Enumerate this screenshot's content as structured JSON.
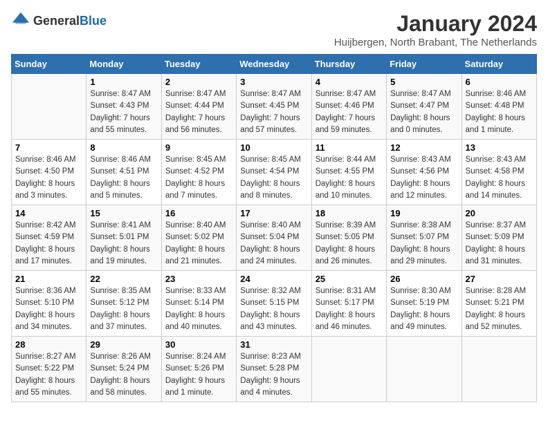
{
  "header": {
    "logo_general": "General",
    "logo_blue": "Blue",
    "title": "January 2024",
    "subtitle": "Huijbergen, North Brabant, The Netherlands"
  },
  "calendar": {
    "days_of_week": [
      "Sunday",
      "Monday",
      "Tuesday",
      "Wednesday",
      "Thursday",
      "Friday",
      "Saturday"
    ],
    "weeks": [
      [
        {
          "day": "",
          "info": ""
        },
        {
          "day": "1",
          "info": "Sunrise: 8:47 AM\nSunset: 4:43 PM\nDaylight: 7 hours\nand 55 minutes."
        },
        {
          "day": "2",
          "info": "Sunrise: 8:47 AM\nSunset: 4:44 PM\nDaylight: 7 hours\nand 56 minutes."
        },
        {
          "day": "3",
          "info": "Sunrise: 8:47 AM\nSunset: 4:45 PM\nDaylight: 7 hours\nand 57 minutes."
        },
        {
          "day": "4",
          "info": "Sunrise: 8:47 AM\nSunset: 4:46 PM\nDaylight: 7 hours\nand 59 minutes."
        },
        {
          "day": "5",
          "info": "Sunrise: 8:47 AM\nSunset: 4:47 PM\nDaylight: 8 hours\nand 0 minutes."
        },
        {
          "day": "6",
          "info": "Sunrise: 8:46 AM\nSunset: 4:48 PM\nDaylight: 8 hours\nand 1 minute."
        }
      ],
      [
        {
          "day": "7",
          "info": "Sunrise: 8:46 AM\nSunset: 4:50 PM\nDaylight: 8 hours\nand 3 minutes."
        },
        {
          "day": "8",
          "info": "Sunrise: 8:46 AM\nSunset: 4:51 PM\nDaylight: 8 hours\nand 5 minutes."
        },
        {
          "day": "9",
          "info": "Sunrise: 8:45 AM\nSunset: 4:52 PM\nDaylight: 8 hours\nand 7 minutes."
        },
        {
          "day": "10",
          "info": "Sunrise: 8:45 AM\nSunset: 4:54 PM\nDaylight: 8 hours\nand 8 minutes."
        },
        {
          "day": "11",
          "info": "Sunrise: 8:44 AM\nSunset: 4:55 PM\nDaylight: 8 hours\nand 10 minutes."
        },
        {
          "day": "12",
          "info": "Sunrise: 8:43 AM\nSunset: 4:56 PM\nDaylight: 8 hours\nand 12 minutes."
        },
        {
          "day": "13",
          "info": "Sunrise: 8:43 AM\nSunset: 4:58 PM\nDaylight: 8 hours\nand 14 minutes."
        }
      ],
      [
        {
          "day": "14",
          "info": "Sunrise: 8:42 AM\nSunset: 4:59 PM\nDaylight: 8 hours\nand 17 minutes."
        },
        {
          "day": "15",
          "info": "Sunrise: 8:41 AM\nSunset: 5:01 PM\nDaylight: 8 hours\nand 19 minutes."
        },
        {
          "day": "16",
          "info": "Sunrise: 8:40 AM\nSunset: 5:02 PM\nDaylight: 8 hours\nand 21 minutes."
        },
        {
          "day": "17",
          "info": "Sunrise: 8:40 AM\nSunset: 5:04 PM\nDaylight: 8 hours\nand 24 minutes."
        },
        {
          "day": "18",
          "info": "Sunrise: 8:39 AM\nSunset: 5:05 PM\nDaylight: 8 hours\nand 26 minutes."
        },
        {
          "day": "19",
          "info": "Sunrise: 8:38 AM\nSunset: 5:07 PM\nDaylight: 8 hours\nand 29 minutes."
        },
        {
          "day": "20",
          "info": "Sunrise: 8:37 AM\nSunset: 5:09 PM\nDaylight: 8 hours\nand 31 minutes."
        }
      ],
      [
        {
          "day": "21",
          "info": "Sunrise: 8:36 AM\nSunset: 5:10 PM\nDaylight: 8 hours\nand 34 minutes."
        },
        {
          "day": "22",
          "info": "Sunrise: 8:35 AM\nSunset: 5:12 PM\nDaylight: 8 hours\nand 37 minutes."
        },
        {
          "day": "23",
          "info": "Sunrise: 8:33 AM\nSunset: 5:14 PM\nDaylight: 8 hours\nand 40 minutes."
        },
        {
          "day": "24",
          "info": "Sunrise: 8:32 AM\nSunset: 5:15 PM\nDaylight: 8 hours\nand 43 minutes."
        },
        {
          "day": "25",
          "info": "Sunrise: 8:31 AM\nSunset: 5:17 PM\nDaylight: 8 hours\nand 46 minutes."
        },
        {
          "day": "26",
          "info": "Sunrise: 8:30 AM\nSunset: 5:19 PM\nDaylight: 8 hours\nand 49 minutes."
        },
        {
          "day": "27",
          "info": "Sunrise: 8:28 AM\nSunset: 5:21 PM\nDaylight: 8 hours\nand 52 minutes."
        }
      ],
      [
        {
          "day": "28",
          "info": "Sunrise: 8:27 AM\nSunset: 5:22 PM\nDaylight: 8 hours\nand 55 minutes."
        },
        {
          "day": "29",
          "info": "Sunrise: 8:26 AM\nSunset: 5:24 PM\nDaylight: 8 hours\nand 58 minutes."
        },
        {
          "day": "30",
          "info": "Sunrise: 8:24 AM\nSunset: 5:26 PM\nDaylight: 9 hours\nand 1 minute."
        },
        {
          "day": "31",
          "info": "Sunrise: 8:23 AM\nSunset: 5:28 PM\nDaylight: 9 hours\nand 4 minutes."
        },
        {
          "day": "",
          "info": ""
        },
        {
          "day": "",
          "info": ""
        },
        {
          "day": "",
          "info": ""
        }
      ]
    ]
  }
}
